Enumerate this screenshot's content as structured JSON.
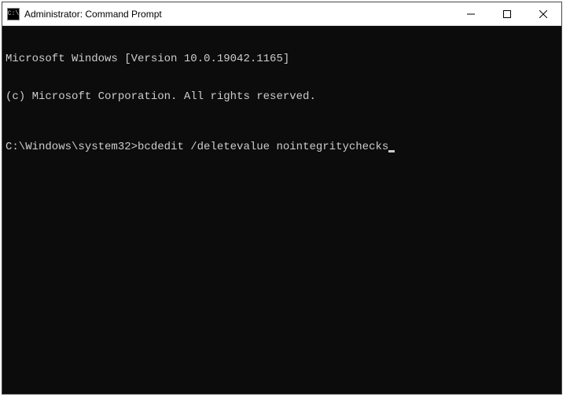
{
  "titlebar": {
    "icon_label": "C:\\",
    "title": "Administrator: Command Prompt"
  },
  "terminal": {
    "line1": "Microsoft Windows [Version 10.0.19042.1165]",
    "line2": "(c) Microsoft Corporation. All rights reserved.",
    "prompt": "C:\\Windows\\system32>",
    "command": "bcdedit /deletevalue nointegritychecks"
  }
}
